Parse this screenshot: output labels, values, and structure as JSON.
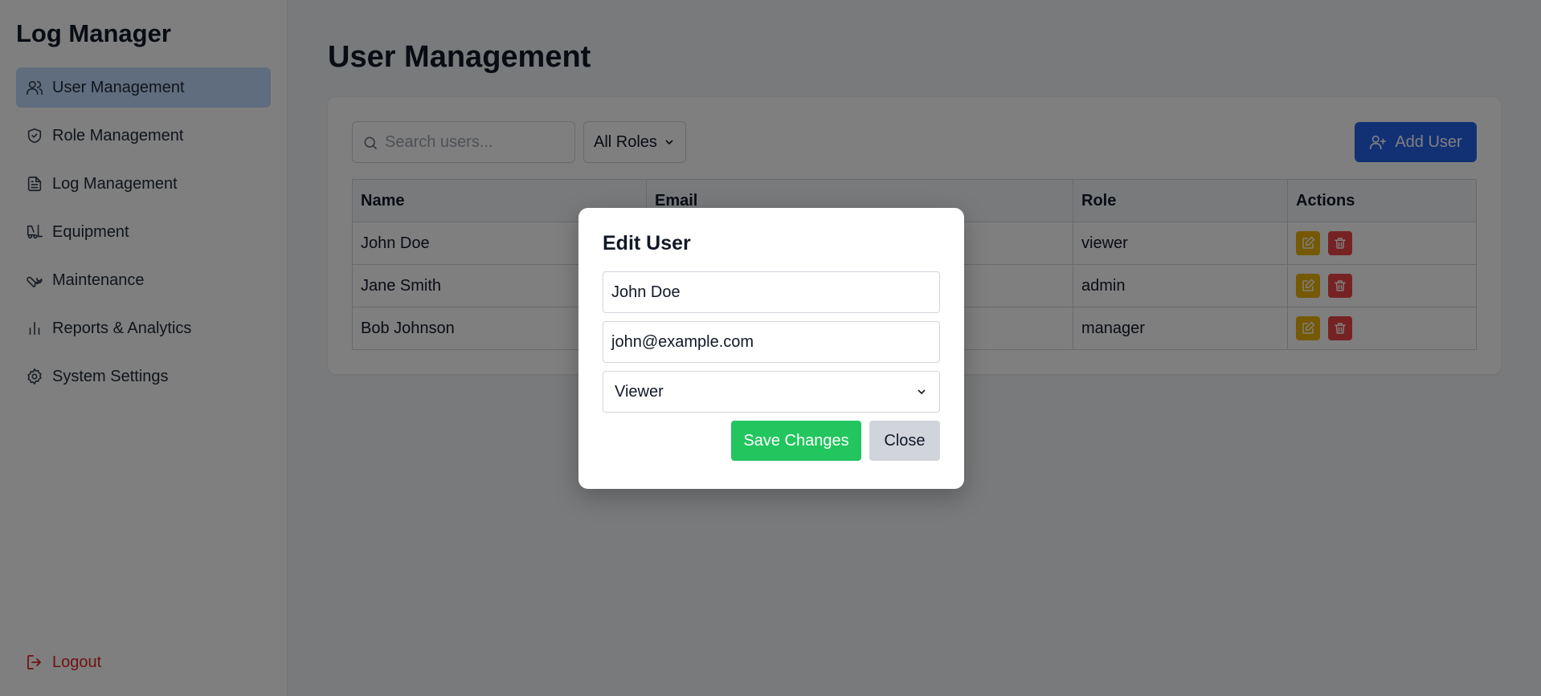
{
  "app": {
    "title": "Log Manager"
  },
  "sidebar": {
    "items": [
      {
        "label": "User Management",
        "icon": "users-icon",
        "active": true
      },
      {
        "label": "Role Management",
        "icon": "shield-icon",
        "active": false
      },
      {
        "label": "Log Management",
        "icon": "document-icon",
        "active": false
      },
      {
        "label": "Equipment",
        "icon": "forklift-icon",
        "active": false
      },
      {
        "label": "Maintenance",
        "icon": "wrench-icon",
        "active": false
      },
      {
        "label": "Reports & Analytics",
        "icon": "bar-chart-icon",
        "active": false
      },
      {
        "label": "System Settings",
        "icon": "gear-icon",
        "active": false
      }
    ],
    "logout_label": "Logout"
  },
  "main": {
    "title": "User Management",
    "search": {
      "placeholder": "Search users...",
      "value": ""
    },
    "role_filter": {
      "selected": "All Roles"
    },
    "add_user_label": "Add User",
    "table": {
      "headers": [
        "Name",
        "Email",
        "Role",
        "Actions"
      ],
      "rows": [
        {
          "name": "John Doe",
          "role": "viewer"
        },
        {
          "name": "Jane Smith",
          "role": "admin"
        },
        {
          "name": "Bob Johnson",
          "role": "manager"
        }
      ]
    }
  },
  "modal": {
    "title": "Edit User",
    "name_value": "John Doe",
    "email_value": "john@example.com",
    "role_selected": "Viewer",
    "save_label": "Save Changes",
    "close_label": "Close"
  },
  "colors": {
    "accent": "#2563eb",
    "active_nav": "#bfdbfe",
    "save": "#22c55e",
    "edit": "#eab308",
    "delete": "#ef4444",
    "logout": "#dc2626"
  }
}
